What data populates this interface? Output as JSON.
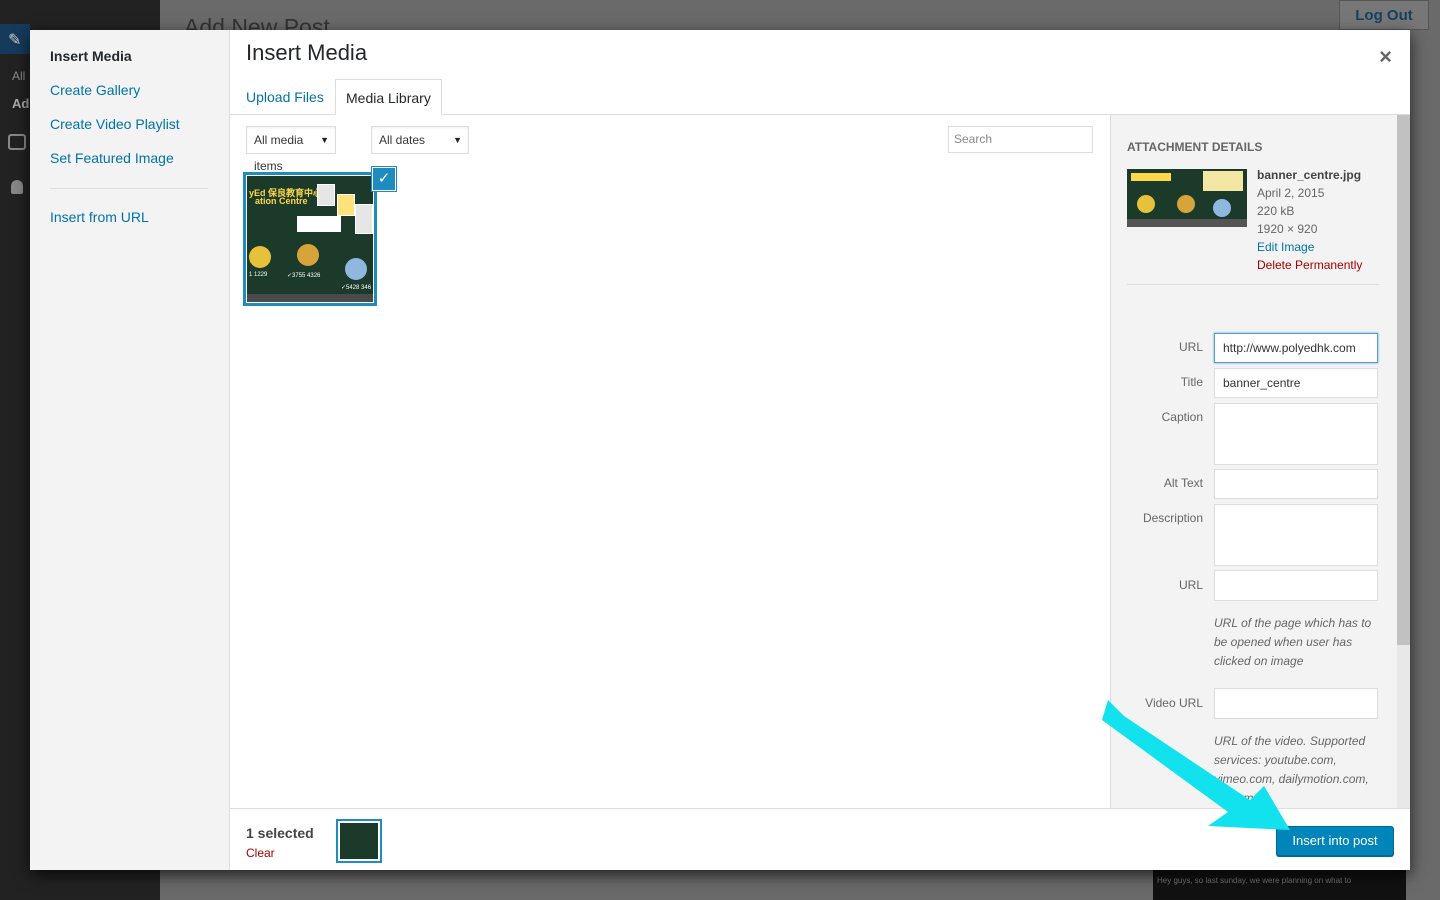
{
  "background": {
    "page_title": "Add New Post",
    "logout_label": "Log Out",
    "menu_text_1": "All",
    "menu_text_2": "Ad",
    "video_caption": "Hey guys, so last sunday, we were planning on what to"
  },
  "modal": {
    "menu": {
      "items": [
        {
          "label": "Insert Media"
        },
        {
          "label": "Create Gallery"
        },
        {
          "label": "Create Video Playlist"
        },
        {
          "label": "Set Featured Image"
        },
        {
          "label": "Insert from URL"
        }
      ]
    },
    "title": "Insert Media",
    "close_glyph": "×",
    "tabs": [
      {
        "label": "Upload Files"
      },
      {
        "label": "Media Library"
      }
    ],
    "filters": {
      "media_type": "All media items",
      "dates": "All dates",
      "search_placeholder": "Search"
    },
    "attachment": {
      "check_glyph": "✓",
      "banner_title": "yEd 保良教育中心",
      "banner_sub": "ation Centre",
      "tel_1": "1 1229",
      "tel_2": "✓3755 4326",
      "tel_3": "✓5428 346"
    },
    "details": {
      "heading": "ATTACHMENT DETAILS",
      "filename": "banner_centre.jpg",
      "date": "April 2, 2015",
      "size": "220 kB",
      "dimensions": "1920 × 920",
      "edit_link": "Edit Image",
      "delete_link": "Delete Permanently",
      "fields": {
        "url_label": "URL",
        "url_value": "http://www.polyedhk.com",
        "title_label": "Title",
        "title_value": "banner_centre",
        "caption_label": "Caption",
        "alt_label": "Alt Text",
        "description_label": "Description",
        "link_url_label": "URL",
        "link_url_hint": "URL of the page which has to be opened when user has clicked on image",
        "video_url_label": "Video URL",
        "video_url_hint": "URL of the video. Supported services: youtube.com, vimeo.com, dailymotion.com, ... .com"
      }
    },
    "toolbar": {
      "selected_count": "1 selected",
      "clear_label": "Clear",
      "insert_button": "Insert into post"
    }
  },
  "colors": {
    "accent": "#0085ba",
    "link": "#0073aa",
    "danger": "#a00",
    "annotation_arrow": "#12e2ee"
  }
}
